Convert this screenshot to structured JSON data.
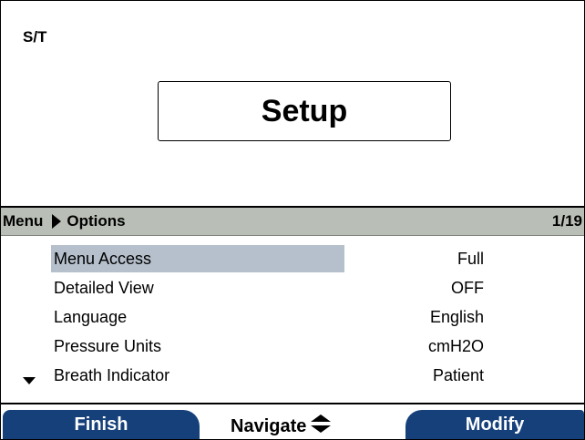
{
  "header": {
    "mode": "S/T",
    "title": "Setup"
  },
  "breadcrumb": {
    "root": "Menu",
    "current": "Options",
    "page": "1/19"
  },
  "menu": {
    "items": [
      {
        "label": "Menu Access",
        "value": "Full",
        "selected": true
      },
      {
        "label": "Detailed View",
        "value": "OFF",
        "selected": false
      },
      {
        "label": "Language",
        "value": "English",
        "selected": false
      },
      {
        "label": "Pressure Units",
        "value": "cmH2O",
        "selected": false
      },
      {
        "label": "Breath Indicator",
        "value": "Patient",
        "selected": false
      }
    ]
  },
  "softkeys": {
    "left": "Finish",
    "center": "Navigate",
    "right": "Modify"
  },
  "icons": {
    "breadcrumb_separator": "triangle-right-icon",
    "scroll_more": "triangle-down-icon",
    "navigate": "up-down-arrow-icon"
  },
  "colors": {
    "breadcrumb_bg": "#b9bfb6",
    "selection_bg": "#b5c0cc",
    "softkey_bg": "#16407a"
  }
}
